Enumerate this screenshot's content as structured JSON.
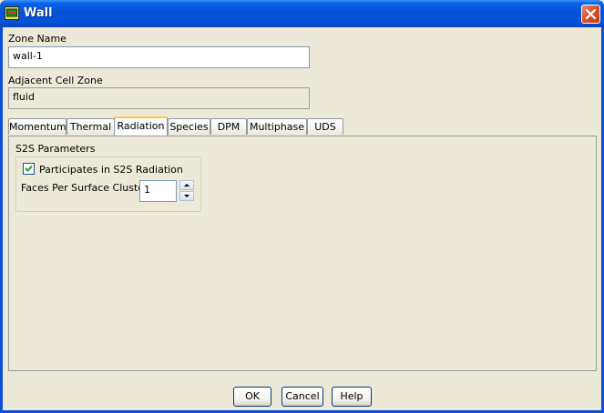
{
  "window": {
    "title": "Wall",
    "colors": {
      "titlebar": "#0a5bde",
      "face": "#ece9d8",
      "active_tab_border": "#ffc83c"
    }
  },
  "fields": {
    "zone_name_label": "Zone Name",
    "zone_name_value": "wall-1",
    "adjacent_label": "Adjacent Cell Zone",
    "adjacent_value": "fluid"
  },
  "tabs": {
    "momentum": "Momentum",
    "thermal": "Thermal",
    "radiation": "Radiation",
    "species": "Species",
    "dpm": "DPM",
    "multiphase": "Multiphase",
    "uds": "UDS",
    "active": "Radiation"
  },
  "radiation": {
    "group_title": "S2S Parameters",
    "participates_label": "Participates in S2S Radiation",
    "participates_checked": true,
    "faces_label": "Faces Per Surface Cluster",
    "faces_value": "1"
  },
  "buttons": {
    "ok": "OK",
    "cancel": "Cancel",
    "help": "Help"
  },
  "icons": {
    "title": "app-icon",
    "close": "close-icon",
    "check": "check-icon",
    "up": "arrow-up-icon",
    "down": "arrow-down-icon"
  }
}
